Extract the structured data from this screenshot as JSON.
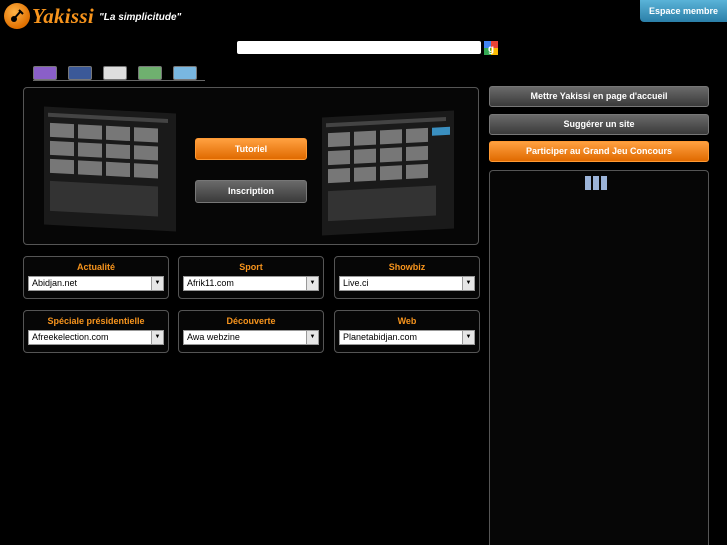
{
  "brand": {
    "name": "Yakissi",
    "slogan": "\"La simplicitude\""
  },
  "header": {
    "member_button": "Espace membre"
  },
  "tabs": [
    {
      "icon": "yahoo-icon",
      "color": "#8a5fc8"
    },
    {
      "icon": "facebook-icon",
      "color": "#3b5998"
    },
    {
      "icon": "youtube-icon",
      "color": "#dddddd"
    },
    {
      "icon": "msn-icon",
      "color": "#6fb06f"
    },
    {
      "icon": "skype-icon",
      "color": "#79b7e0"
    }
  ],
  "main": {
    "tutorial_button": "Tutoriel",
    "signup_button": "Inscription"
  },
  "sidebar": {
    "homepage_button": "Mettre Yakissi en page d'accueil",
    "suggest_button": "Suggérer un site",
    "contest_button": "Participer au Grand Jeu Concours"
  },
  "categories": [
    {
      "title": "Actualité",
      "selected": "Abidjan.net"
    },
    {
      "title": "Sport",
      "selected": "Afrik11.com"
    },
    {
      "title": "Showbiz",
      "selected": "Live.ci"
    },
    {
      "title": "Spéciale présidentielle",
      "selected": "Afreekelection.com"
    },
    {
      "title": "Découverte",
      "selected": "Awa webzine"
    },
    {
      "title": "Web",
      "selected": "Planetabidjan.com"
    }
  ]
}
